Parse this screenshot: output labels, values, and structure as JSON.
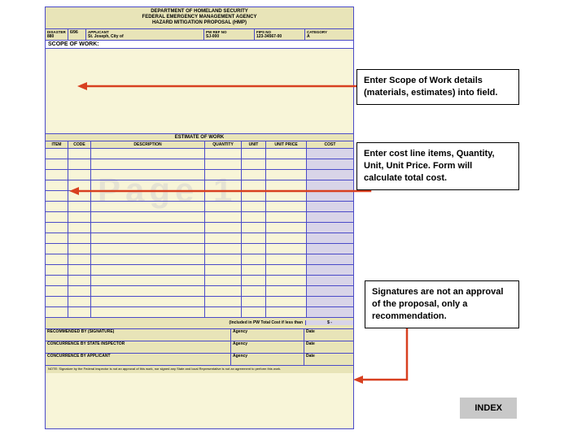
{
  "form": {
    "dept": "DEPARTMENT OF HOMELAND SECURITY",
    "agency": "FEDERAL EMERGENCY MANAGEMENT AGENCY",
    "title": "HAZARD MITIGATION PROPOSAL (HMP)",
    "row1": {
      "disaster_label": "DISASTER",
      "disaster": "880",
      "date_label": "",
      "date": "6/96",
      "applicant_label": "APPLICANT",
      "applicant": "St. Joseph, City of",
      "pwref_label": "PW REF NO",
      "pwref": "SJ-000",
      "fips_label": "FIPS NO",
      "fips": "123-34567-00",
      "category_label": "CATEGORY",
      "category": "A"
    },
    "scope_label": "SCOPE OF WORK:",
    "estimate_header": "ESTIMATE OF WORK",
    "cols": {
      "item": "ITEM",
      "code": "CODE",
      "desc": "DESCRIPTION",
      "qty": "QUANTITY",
      "unit": "UNIT",
      "uprice": "UNIT PRICE",
      "cost": "COST"
    },
    "total_label": "(Included in PW Total Cost if less than",
    "total_val": "$  -",
    "sig": {
      "rec": "RECOMMENDED BY (SIGNATURE)",
      "conc": "CONCURRENCE BY STATE INSPECTOR",
      "conc2": "CONCURRENCE BY APPLICANT",
      "agency": "Agency",
      "date": "Date"
    },
    "note": "NOTE: Signature by the Federal inspector is not an approval of this work, nor signed any State and local Representative is not an agreement to perform this work."
  },
  "watermark": "Page 1",
  "callouts": {
    "c1": "Enter Scope of Work details (materials, estimates) into field.",
    "c2": "Enter cost line items, Quantity, Unit, Unit Price. Form will calculate total cost.",
    "c3": "Signatures are not an approval of the proposal, only a recommendation."
  },
  "index_label": "INDEX"
}
